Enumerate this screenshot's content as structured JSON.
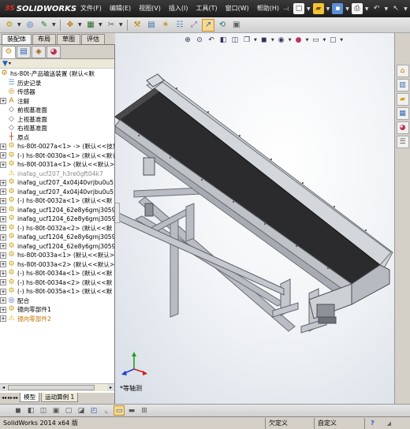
{
  "app": {
    "logo_ds": "3S",
    "logo_name": "SOLIDWORKS"
  },
  "menu": {
    "items": [
      "文件(F)",
      "编辑(E)",
      "视图(V)",
      "插入(I)",
      "工具(T)",
      "窗口(W)",
      "帮助(H)"
    ]
  },
  "command_tabs": [
    "装配体",
    "布局",
    "草图",
    "评估"
  ],
  "property_tabs": [
    "feature-tree-icon",
    "property-manager-icon",
    "config-manager-icon",
    "display-manager-icon"
  ],
  "tree": {
    "root": "hs-80t-产品输送装置  (默认<默",
    "items": [
      {
        "label": "历史记录",
        "icon": "history-icon",
        "expand": false,
        "style": ""
      },
      {
        "label": "传感器",
        "icon": "sensor-icon",
        "expand": false,
        "style": ""
      },
      {
        "label": "注解",
        "icon": "annotation-icon",
        "expand": true,
        "style": ""
      },
      {
        "label": "前视基准面",
        "icon": "plane-icon",
        "expand": false,
        "style": ""
      },
      {
        "label": "上视基准面",
        "icon": "plane-icon",
        "expand": false,
        "style": ""
      },
      {
        "label": "右视基准面",
        "icon": "plane-icon",
        "expand": false,
        "style": ""
      },
      {
        "label": "原点",
        "icon": "origin-icon",
        "expand": false,
        "style": ""
      },
      {
        "label": "hs-80t-0027a<1> -> (默认<<技加",
        "icon": "part-icon",
        "expand": true,
        "style": ""
      },
      {
        "label": "(-) hs-80t-0030a<1> (默认<<默认",
        "icon": "part-icon",
        "expand": true,
        "style": ""
      },
      {
        "label": "hs-80t-0031a<1> (默认<<默认>_",
        "icon": "part-icon",
        "expand": true,
        "style": ""
      },
      {
        "label": "inafag_ucf207_h3re0gft04k7",
        "icon": "warning-icon",
        "expand": false,
        "style": "dim"
      },
      {
        "label": "inafag_ucf207_4x04j40vrjbu0u5",
        "icon": "part-icon",
        "expand": true,
        "style": ""
      },
      {
        "label": "inafag_ucf207_4x04j40vrjbu0u5",
        "icon": "part-icon",
        "expand": true,
        "style": ""
      },
      {
        "label": "(-) hs-80t-0032a<1> (默认<<默",
        "icon": "part-icon",
        "expand": true,
        "style": ""
      },
      {
        "label": "inafag_ucf1204_62e8y6gmj3059u",
        "icon": "part-icon",
        "expand": true,
        "style": ""
      },
      {
        "label": "inafag_ucf1204_62e8y6gmj3059u",
        "icon": "part-icon",
        "expand": true,
        "style": ""
      },
      {
        "label": "(-) hs-80t-0032a<2> (默认<<默",
        "icon": "part-icon",
        "expand": true,
        "style": ""
      },
      {
        "label": "inafag_ucf1204_62e8y6gmj3059u",
        "icon": "part-icon",
        "expand": true,
        "style": ""
      },
      {
        "label": "inafag_ucf1204_62e8y6gmj3059u",
        "icon": "part-icon",
        "expand": true,
        "style": ""
      },
      {
        "label": "hs-80t-0033a<1> (默认<<默认>_",
        "icon": "part-icon",
        "expand": true,
        "style": ""
      },
      {
        "label": "hs-80t-0033a<2> (默认<<默认>_",
        "icon": "part-icon",
        "expand": true,
        "style": ""
      },
      {
        "label": "(-) hs-80t-0034a<1> (默认<<默",
        "icon": "part-icon",
        "expand": true,
        "style": ""
      },
      {
        "label": "(-) hs-80t-0034a<2> (默认<<默",
        "icon": "part-icon",
        "expand": true,
        "style": ""
      },
      {
        "label": "(-) hs-80t-0035a<1> (默认<<默",
        "icon": "part-icon",
        "expand": true,
        "style": ""
      },
      {
        "label": "配合",
        "icon": "mate-icon",
        "expand": true,
        "style": ""
      },
      {
        "label": "镜向零部件1",
        "icon": "mirror-icon",
        "expand": true,
        "style": ""
      },
      {
        "label": "镜向零部件2",
        "icon": "warning-icon",
        "expand": true,
        "style": "warn"
      }
    ]
  },
  "bottom_tabs": [
    "模型",
    "运动算例 1"
  ],
  "graphics": {
    "view_label": "*等轴测",
    "background_top": "#ffffff",
    "background_bottom": "#d7dde6"
  },
  "status": {
    "app_version": "SolidWorks 2014 x64 版",
    "undefined": "欠定义",
    "custom": "自定义",
    "help": "?"
  },
  "colors": {
    "accent": "#e03020",
    "title_bg": "#262626",
    "tree_warn": "#c07000"
  }
}
